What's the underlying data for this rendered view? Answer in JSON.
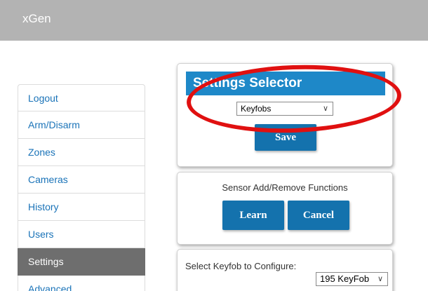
{
  "header": {
    "brand": "xGen"
  },
  "sidebar": {
    "items": [
      {
        "label": "Logout"
      },
      {
        "label": "Arm/Disarm"
      },
      {
        "label": "Zones"
      },
      {
        "label": "Cameras"
      },
      {
        "label": "History"
      },
      {
        "label": "Users"
      },
      {
        "label": "Settings",
        "active": true
      },
      {
        "label": "Advanced"
      }
    ]
  },
  "settings_selector": {
    "title": "Settings Selector",
    "selected": "Keyfobs",
    "save_label": "Save"
  },
  "sensor_panel": {
    "title": "Sensor Add/Remove Functions",
    "learn_label": "Learn",
    "cancel_label": "Cancel"
  },
  "keyfob_panel": {
    "label": "Select Keyfob to Configure:",
    "selected": "195 KeyFob"
  },
  "colors": {
    "accent": "#1e88c8",
    "button": "#1472ad",
    "active_nav": "#6e6e6e",
    "annotation": "#e01010",
    "header": "#b3b3b3"
  }
}
